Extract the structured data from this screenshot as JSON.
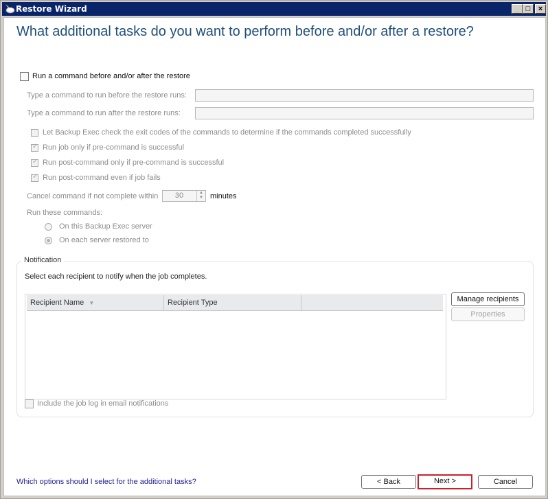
{
  "window": {
    "title": "Restore Wizard",
    "icon": "restore-wizard-icon",
    "controls": {
      "minimize": "_",
      "maximize": "□",
      "close": "×"
    }
  },
  "heading": "What additional tasks do you want to perform before and/or after a restore?",
  "command_section": {
    "main_checkbox": {
      "label": "Run a command before and/or after the restore",
      "checked": false
    },
    "pre_command": {
      "label": "Type a command to run before the restore runs:",
      "value": ""
    },
    "post_command": {
      "label": "Type a command to run after the restore runs:",
      "value": ""
    },
    "options": [
      {
        "label": "Let Backup Exec check the exit codes of the commands to determine if the commands completed successfully",
        "checked": false
      },
      {
        "label": "Run job only if pre-command is successful",
        "checked": true
      },
      {
        "label": "Run post-command only if pre-command is successful",
        "checked": true
      },
      {
        "label": "Run post-command even if job fails",
        "checked": true
      }
    ],
    "cancel_label": "Cancel command if not complete within",
    "cancel_value": "30",
    "cancel_unit": "minutes",
    "run_label": "Run these commands:",
    "run_options": [
      {
        "label": "On this Backup Exec server",
        "selected": false
      },
      {
        "label": "On each server restored to",
        "selected": true
      }
    ]
  },
  "notification": {
    "title": "Notification",
    "instruction": "Select each recipient to notify when the job completes.",
    "columns": [
      "Recipient Name",
      "Recipient Type",
      ""
    ],
    "sort_icon": "sort-down-icon",
    "rows": [],
    "manage_button": "Manage recipients",
    "properties_button": "Properties",
    "include_log": {
      "label": "Include the job log in email notifications",
      "checked": false
    }
  },
  "footer": {
    "help_link": "Which options should I select for the additional tasks?",
    "back": "< Back",
    "next": "Next >",
    "cancel": "Cancel"
  }
}
